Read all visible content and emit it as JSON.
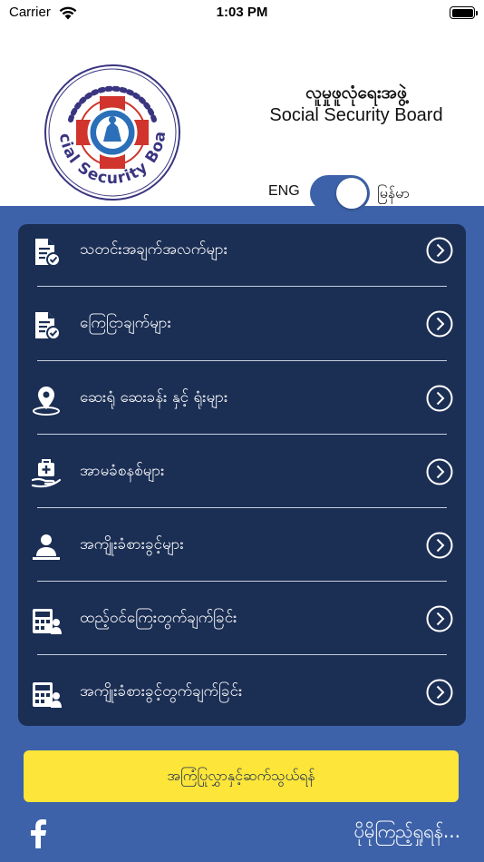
{
  "status_bar": {
    "carrier": "Carrier",
    "time": "1:03 PM"
  },
  "header": {
    "logo_text": "Social Security Board",
    "title_mm": "လူမှုဖူလုံရေးအဖွဲ့",
    "title_en": "Social Security Board",
    "lang_eng": "ENG",
    "lang_mm": "မြန်မာ",
    "toggle_state": "on"
  },
  "menu": {
    "items": [
      {
        "label": "သတင်းအချက်အလက်များ",
        "icon": "document-check-icon"
      },
      {
        "label": "ကြေငြာချက်များ",
        "icon": "announcement-document-icon"
      },
      {
        "label": "ဆေးရုံ ဆေးခန်း နှင့် ရုံးများ",
        "icon": "location-pin-icon"
      },
      {
        "label": "အာမခံစနစ်များ",
        "icon": "medical-kit-hand-icon"
      },
      {
        "label": "အကျိုးခံစားခွင့်များ",
        "icon": "person-benefit-icon"
      },
      {
        "label": "ထည့်ဝင်ကြေးတွက်ချက်ခြင်း",
        "icon": "calculator-icon"
      },
      {
        "label": "အကျိုးခံစားခွင့်တွက်ချက်ခြင်း",
        "icon": "calculator-person-icon"
      }
    ]
  },
  "contact_button": "အကြံပြုလွှာနှင့်ဆက်သွယ်ရန်",
  "more_link": "ပိုမိုကြည့်ရှုရန်...",
  "colors": {
    "primary": "#3d62a9",
    "card": "#1b2e54",
    "button": "#fde539",
    "logo_red": "#d0342c"
  }
}
